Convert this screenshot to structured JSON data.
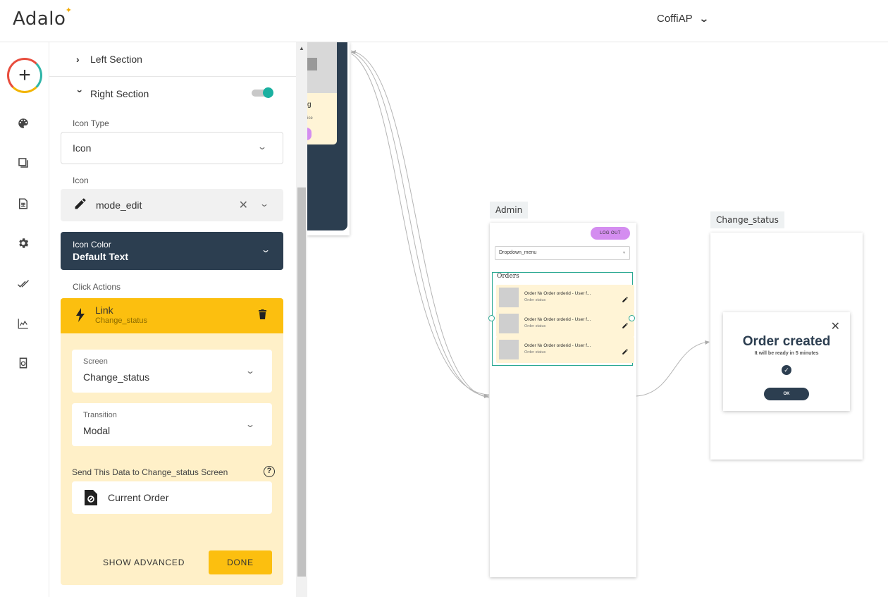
{
  "header": {
    "logo": "Adalo",
    "app_name": "CoffiAP"
  },
  "panel": {
    "left_section": "Left Section",
    "right_section": "Right Section",
    "icon_type_label": "Icon Type",
    "icon_type_value": "Icon",
    "icon_label": "Icon",
    "icon_value": "mode_edit",
    "icon_color_label": "Icon Color",
    "icon_color_value": "Default Text",
    "click_actions_label": "Click Actions",
    "action": {
      "title": "Link",
      "subtitle": "Change_status",
      "screen_label": "Screen",
      "screen_value": "Change_status",
      "transition_label": "Transition",
      "transition_value": "Modal",
      "send_data_label": "Send This Data to Change_status Screen",
      "send_data_value": "Current Order",
      "show_advanced": "SHOW ADVANCED",
      "done": "DONE"
    }
  },
  "canvas": {
    "frag_text": "g",
    "frag_small": "ice",
    "admin": {
      "tag": "Admin",
      "logout": "LOG OUT",
      "dropdown": "Dropdown_menu",
      "orders_title": "Orders",
      "items": [
        {
          "title": "Order № Order orderid - User f...",
          "subtitle": "Order status"
        },
        {
          "title": "Order № Order orderid - User f...",
          "subtitle": "Order status"
        },
        {
          "title": "Order № Order orderid - User f...",
          "subtitle": "Order status"
        }
      ]
    },
    "change_status": {
      "tag": "Change_status",
      "modal_title": "Order created",
      "modal_sub": "It will be ready in 5 minutes",
      "ok": "OK"
    }
  },
  "colors": {
    "accent_yellow": "#fcbf0f",
    "cream": "#fff0c8",
    "navy": "#2c3e50",
    "teal": "#1ab0a0",
    "pink": "#d48df0"
  }
}
